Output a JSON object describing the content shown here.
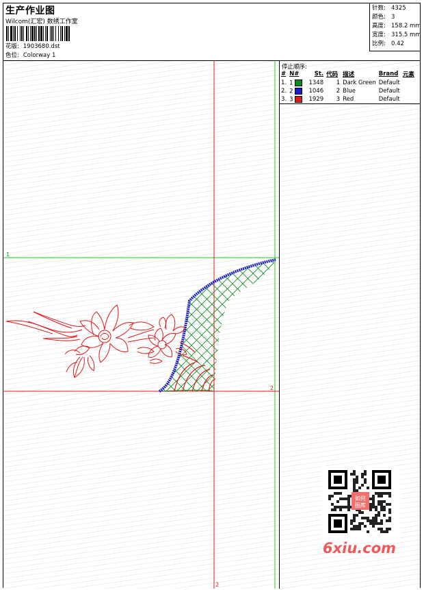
{
  "header": {
    "title": "生产作业图",
    "company": "Wilcom(汇宏) 数绣工作室",
    "design_label": "花版:",
    "design_file": "1903680.dst",
    "colorway_label": "色位:",
    "colorway": "Colorway 1"
  },
  "stats": [
    {
      "label": "针数:",
      "value": "4325"
    },
    {
      "label": "颜色:",
      "value": "3"
    },
    {
      "label": "高度:",
      "value": "158.2 mm"
    },
    {
      "label": "宽度:",
      "value": "315.5 mm"
    },
    {
      "label": "比例:",
      "value": "0.42"
    }
  ],
  "guides": {
    "horizontal_top_label": "1",
    "horizontal_bottom_label": "2",
    "vertical_bottom_label": "2"
  },
  "stop_sequence": {
    "title": "停止顺序:",
    "columns": [
      "#",
      "N#",
      "St.",
      "代码",
      "描述",
      "Brand",
      "元素"
    ],
    "rows": [
      {
        "index": "1.",
        "n": "1",
        "stitches": "1348",
        "code": "1",
        "desc": "Dark Green",
        "brand": "Default",
        "color": "#0a8a1e"
      },
      {
        "index": "2.",
        "n": "2",
        "stitches": "1046",
        "code": "2",
        "desc": "Blue",
        "brand": "Default",
        "color": "#1a1acc"
      },
      {
        "index": "3.",
        "n": "3",
        "stitches": "1929",
        "code": "3",
        "desc": "Red",
        "brand": "Default",
        "color": "#e01818"
      }
    ]
  },
  "watermark": {
    "qr_text": "如何图库",
    "site": "6xiu.com"
  },
  "colors": {
    "guide_green": "#19d219",
    "guide_red": "#e01818",
    "thread_green": "#0a8a1e",
    "thread_blue": "#1a1acc",
    "thread_red": "#e01818"
  }
}
